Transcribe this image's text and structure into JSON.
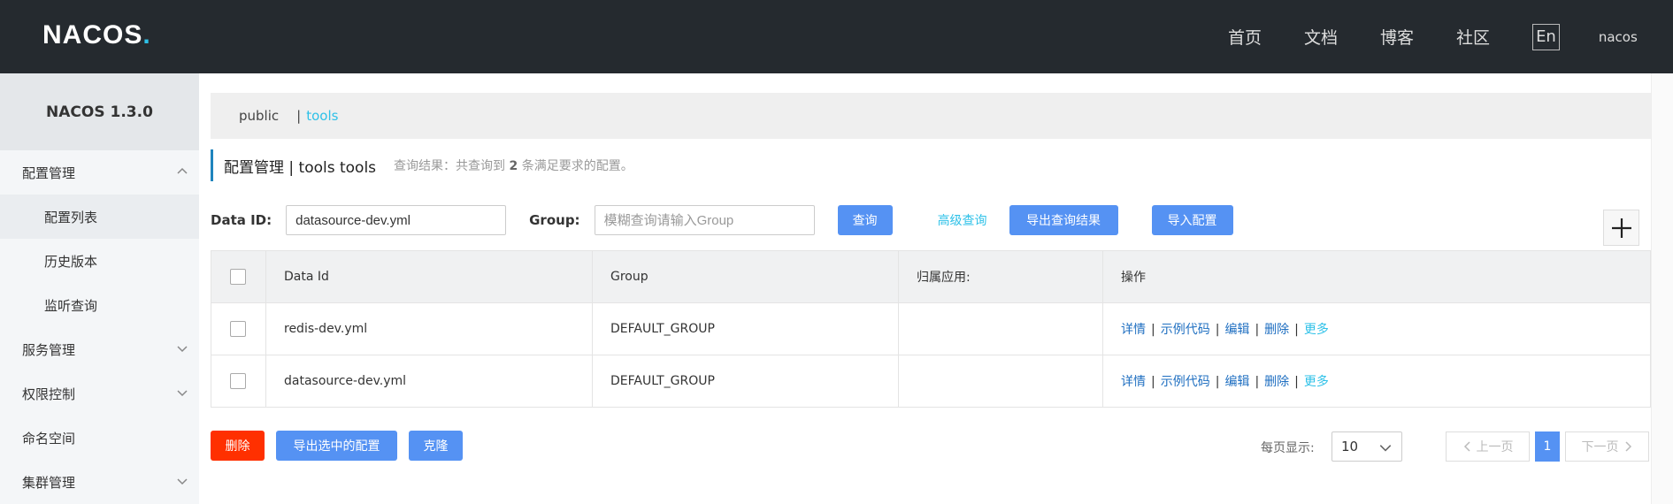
{
  "header": {
    "logo_main": "NACOS",
    "logo_dot": ".",
    "nav": [
      "首页",
      "文档",
      "博客",
      "社区"
    ],
    "lang": "En",
    "user": "nacos"
  },
  "sidebar": {
    "title": "NACOS 1.3.0",
    "items": [
      {
        "label": "配置管理"
      },
      {
        "label": "配置列表"
      },
      {
        "label": "历史版本"
      },
      {
        "label": "监听查询"
      },
      {
        "label": "服务管理"
      },
      {
        "label": "权限控制"
      },
      {
        "label": "命名空间"
      },
      {
        "label": "集群管理"
      }
    ]
  },
  "namespace": {
    "public": "public",
    "sep": "|",
    "tools": "tools"
  },
  "page": {
    "title": "配置管理 | tools tools",
    "hint_prefix": "查询结果：共查询到",
    "hint_count": "2",
    "hint_suffix": "条满足要求的配置。"
  },
  "filters": {
    "data_id_label": "Data ID:",
    "data_id_value": "datasource-dev.yml",
    "group_label": "Group:",
    "group_placeholder": "模糊查询请输入Group",
    "query_btn": "查询",
    "advanced": "高级查询",
    "export_btn": "导出查询结果",
    "import_btn": "导入配置"
  },
  "add_icon": "plus-icon",
  "table": {
    "headers": [
      "Data Id",
      "Group",
      "归属应用:",
      "操作"
    ],
    "rows": [
      {
        "data_id": "redis-dev.yml",
        "group": "DEFAULT_GROUP",
        "app": ""
      },
      {
        "data_id": "datasource-dev.yml",
        "group": "DEFAULT_GROUP",
        "app": ""
      }
    ],
    "ops": {
      "detail": "详情",
      "sample": "示例代码",
      "edit": "编辑",
      "delete": "删除",
      "more": "更多",
      "sep": "|"
    }
  },
  "footer": {
    "delete_btn": "删除",
    "export_selected_btn": "导出选中的配置",
    "clone_btn": "克隆",
    "page_size_label": "每页显示:",
    "page_size": "10",
    "prev": "上一页",
    "current_page": "1",
    "next": "下一页"
  },
  "colors": {
    "header_bg": "#252a2f",
    "primary": "#5592f3",
    "danger": "#ff3000",
    "accent": "#2ec1e8"
  }
}
